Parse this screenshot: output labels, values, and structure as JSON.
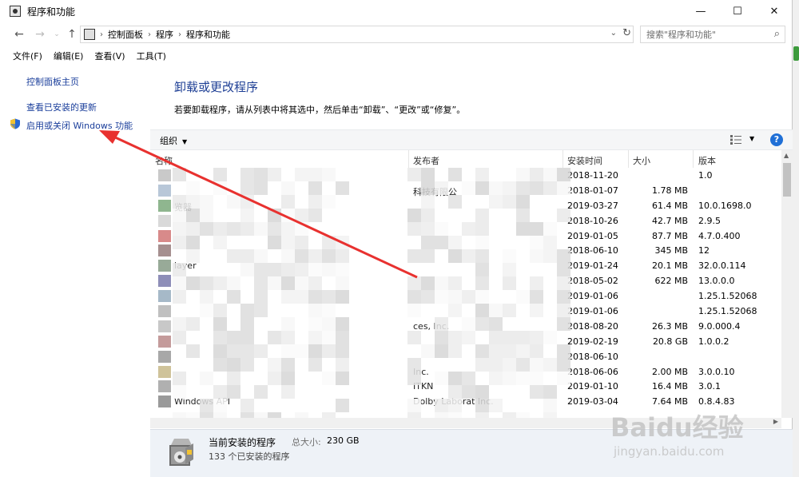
{
  "window": {
    "title": "程序和功能",
    "controls": {
      "minimize": "—",
      "maximize": "☐",
      "close": "✕"
    }
  },
  "address": {
    "crumbs": [
      "控制面板",
      "程序",
      "程序和功能"
    ],
    "search_placeholder": "搜索\"程序和功能\""
  },
  "menu": [
    "文件(F)",
    "编辑(E)",
    "查看(V)",
    "工具(T)"
  ],
  "sidebar": {
    "items": [
      {
        "label": "控制面板主页"
      },
      {
        "label": "查看已安装的更新"
      },
      {
        "label": "启用或关闭 Windows 功能"
      }
    ]
  },
  "main": {
    "title": "卸载或更改程序",
    "description": "若要卸载程序，请从列表中将其选中，然后单击“卸载”、“更改”或“修复”。"
  },
  "toolbar": {
    "organize": "组织",
    "help": "?"
  },
  "columns": {
    "name": "名称",
    "publisher": "发布者",
    "date": "安装时间",
    "size": "大小",
    "version": "版本"
  },
  "rows": [
    {
      "name": "",
      "publisher": "",
      "date": "2018-11-20",
      "size": "",
      "version": "1.0"
    },
    {
      "name": "",
      "publisher": "科技有限公",
      "date": "2018-01-07",
      "size": "1.78 MB",
      "version": ""
    },
    {
      "name": "览器",
      "publisher": "",
      "date": "2019-03-27",
      "size": "61.4 MB",
      "version": "10.0.1698.0"
    },
    {
      "name": "",
      "publisher": "",
      "date": "2018-10-26",
      "size": "42.7 MB",
      "version": "2.9.5"
    },
    {
      "name": "",
      "publisher": "",
      "date": "2019-01-05",
      "size": "87.7 MB",
      "version": "4.7.0.400"
    },
    {
      "name": "",
      "publisher": "",
      "date": "2018-06-10",
      "size": "345 MB",
      "version": "12"
    },
    {
      "name": "layer",
      "publisher": "",
      "date": "2019-01-24",
      "size": "20.1 MB",
      "version": "32.0.0.114"
    },
    {
      "name": "",
      "publisher": "",
      "date": "2018-05-02",
      "size": "622 MB",
      "version": "13.0.0.0"
    },
    {
      "name": "",
      "publisher": "",
      "date": "2019-01-06",
      "size": "",
      "version": "1.25.1.52068"
    },
    {
      "name": "",
      "publisher": "",
      "date": "2019-01-06",
      "size": "",
      "version": "1.25.1.52068"
    },
    {
      "name": "",
      "publisher": "ces, Inc.",
      "date": "2018-08-20",
      "size": "26.3 MB",
      "version": "9.0.000.4"
    },
    {
      "name": "",
      "publisher": "",
      "date": "2019-02-19",
      "size": "20.8 GB",
      "version": "1.0.0.2"
    },
    {
      "name": "",
      "publisher": "",
      "date": "2018-06-10",
      "size": "",
      "version": ""
    },
    {
      "name": "",
      "publisher": "Inc.",
      "date": "2018-06-06",
      "size": "2.00 MB",
      "version": "3.0.0.10"
    },
    {
      "name": "",
      "publisher": "ITKN",
      "date": "2019-01-10",
      "size": "16.4 MB",
      "version": "3.0.1"
    },
    {
      "name": "Windows API",
      "publisher": "Dolby Laborat      Inc.",
      "date": "2019-03-04",
      "size": "7.64 MB",
      "version": "0.8.4.83"
    }
  ],
  "status": {
    "title": "当前安装的程序",
    "size_label": "总大小:",
    "size_value": "230 GB",
    "count": "133 个已安装的程序"
  },
  "watermark": {
    "logo": "Baidu经验",
    "url": "jingyan.baidu.com"
  },
  "colors": {
    "link": "#1a3e9b",
    "title": "#1e3f95",
    "arrow": "#e8312f",
    "help": "#1f6fd6"
  }
}
